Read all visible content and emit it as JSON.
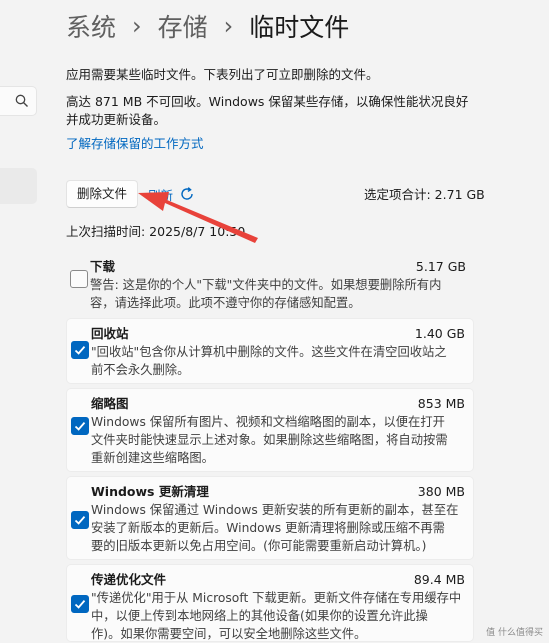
{
  "breadcrumb": {
    "items": [
      "系统",
      "存储",
      "临时文件"
    ],
    "separator": "›"
  },
  "intro": {
    "line1": "应用需要某些临时文件。下表列出了可立即删除的文件。",
    "line2": "高达 871 MB 不可回收。Windows 保留某些存储，以确保性能状况良好",
    "line3": "并成功更新设备。",
    "learn_more_link": "了解存储保留的工作方式"
  },
  "actions": {
    "delete_button": "删除文件",
    "refresh_label": "刷新",
    "selected_total": "选定项合计: 2.71 GB",
    "last_scan": "上次扫描时间: 2025/8/7 10:50"
  },
  "items": [
    {
      "name": "下载",
      "size": "5.17 GB",
      "checked": false,
      "desc": [
        "警告: 这是你的个人\"下载\"文件夹中的文件。如果想要删除所有内",
        "容，请选择此项。此项不遵守你的存储感知配置。"
      ]
    },
    {
      "name": "回收站",
      "size": "1.40 GB",
      "checked": true,
      "desc": [
        "\"回收站\"包含你从计算机中删除的文件。这些文件在清空回收站之",
        "前不会永久删除。"
      ]
    },
    {
      "name": "缩略图",
      "size": "853 MB",
      "checked": true,
      "desc": [
        "Windows 保留所有图片、视频和文档缩略图的副本，以便在打开",
        "文件夹时能快速显示上述对象。如果删除这些缩略图，将自动按需",
        "重新创建这些缩略图。"
      ]
    },
    {
      "name": "Windows 更新清理",
      "size": "380 MB",
      "checked": true,
      "desc": [
        "Windows 保留通过 Windows 更新安装的所有更新的副本，甚至在",
        "安装了新版本的更新后。Windows 更新清理将删除或压缩不再需",
        "要的旧版本更新以免占用空间。(你可能需要重新启动计算机。)"
      ]
    },
    {
      "name": "传递优化文件",
      "size": "89.4 MB",
      "checked": true,
      "desc": [
        "\"传递优化\"用于从 Microsoft 下载更新。更新文件存储在专用缓存中",
        "中，以便上传到本地网络上的其他设备(如果你的设置允许此操",
        "作)。如果你需要空间，可以安全地删除这些文件。"
      ]
    }
  ],
  "watermark": "值 什么值得买",
  "colors": {
    "accent": "#0067c0",
    "annotation_arrow": "#e8423a"
  },
  "icons": {
    "search": "search-icon",
    "refresh": "refresh-icon",
    "checkmark": "checkmark-icon",
    "annotation": "red-arrow-annotation"
  }
}
